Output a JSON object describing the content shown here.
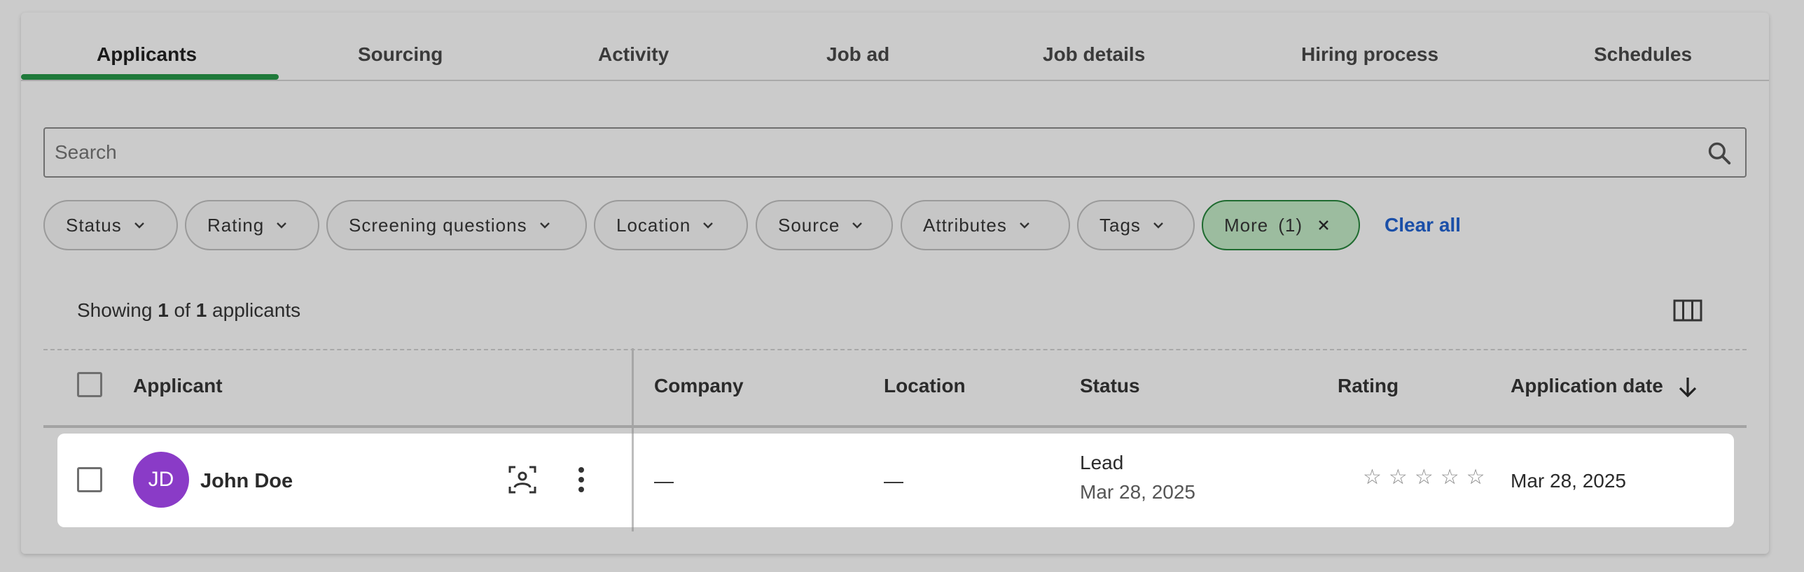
{
  "tabs": [
    {
      "label": "Applicants",
      "active": true
    },
    {
      "label": "Sourcing"
    },
    {
      "label": "Activity"
    },
    {
      "label": "Job ad"
    },
    {
      "label": "Job details"
    },
    {
      "label": "Hiring process"
    },
    {
      "label": "Schedules"
    }
  ],
  "search": {
    "placeholder": "Search",
    "value": ""
  },
  "filters": {
    "chips": [
      {
        "label": "Status"
      },
      {
        "label": "Rating"
      },
      {
        "label": "Screening questions"
      },
      {
        "label": "Location"
      },
      {
        "label": "Source"
      },
      {
        "label": "Attributes"
      },
      {
        "label": "Tags"
      }
    ],
    "more": {
      "label": "More",
      "count": "(1)"
    },
    "clear_all": "Clear all"
  },
  "summary": {
    "prefix": "Showing",
    "shown": "1",
    "of": "of",
    "total": "1",
    "suffix": "applicants"
  },
  "table": {
    "headers": {
      "applicant": "Applicant",
      "company": "Company",
      "location": "Location",
      "status": "Status",
      "rating": "Rating",
      "application_date": "Application date"
    },
    "sort": {
      "column": "Application date",
      "direction": "descending"
    },
    "rows": [
      {
        "initials": "JD",
        "name": "John Doe",
        "company": "—",
        "location": "—",
        "status": "Lead",
        "status_date": "Mar 28, 2025",
        "rating": 0,
        "rating_max": 5,
        "application_date": "Mar 28, 2025"
      }
    ]
  },
  "colors": {
    "accent": "#1f7a3a",
    "active_chip_bg": "#9cbc9f",
    "link": "#1a4fa8",
    "avatar": "#8a3bc7"
  },
  "icons": {
    "search": "search-icon",
    "chevron": "chevron-down-icon",
    "close": "close-icon",
    "columns": "columns-icon",
    "sort": "arrow-down-icon",
    "profile": "profile-scan-icon",
    "more": "more-vertical-icon",
    "star": "star-outline-icon"
  }
}
